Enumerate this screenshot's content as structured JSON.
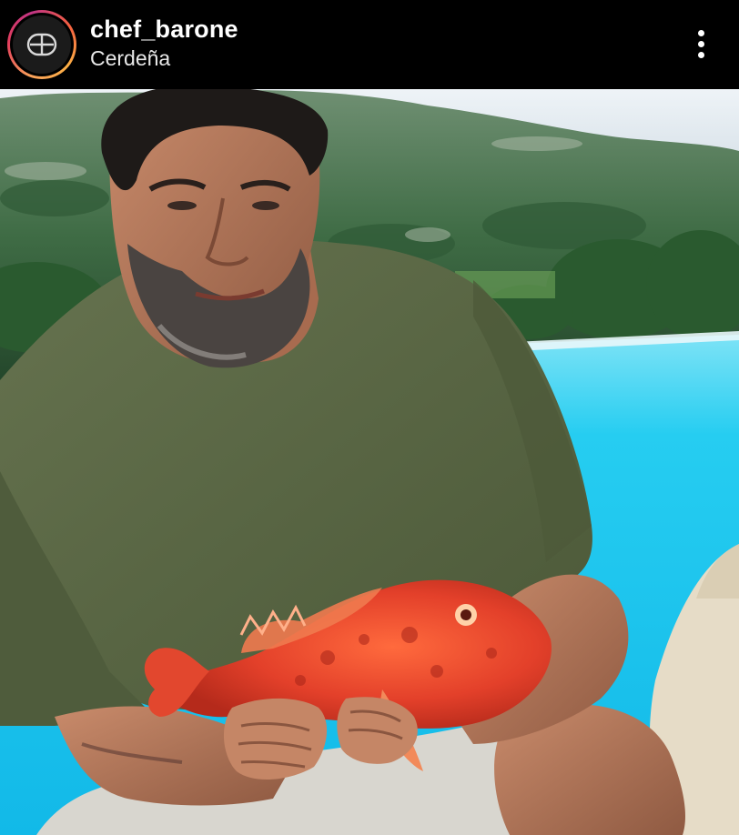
{
  "post": {
    "username": "chef_barone",
    "location": "Cerdeña",
    "avatar_icon": "chef-monogram-logo",
    "more_icon": "more-options-icon",
    "photo": {
      "description_icon": "post-photo",
      "colors": {
        "sky": "#dfe7ee",
        "hills": "#3d6a45",
        "pool": "#1ecbf0",
        "shirt": "#5b6a48",
        "fish": "#e8452a",
        "skin": "#b27458"
      }
    }
  }
}
